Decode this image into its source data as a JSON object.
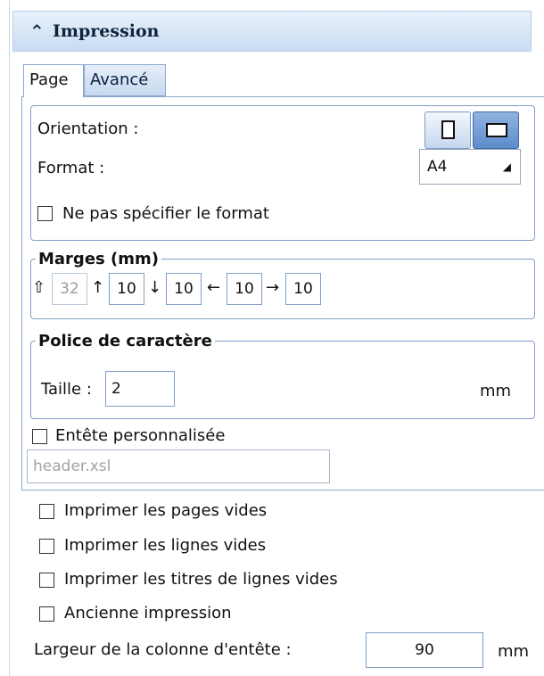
{
  "header": {
    "title": "Impression",
    "icon": "double-chevron-up-icon"
  },
  "tabs": [
    {
      "label": "Page"
    },
    {
      "label": "Avancé"
    }
  ],
  "orientation": {
    "label": "Orientation :"
  },
  "format": {
    "label": "Format :",
    "value": "A4"
  },
  "no_format": {
    "label": "Ne pas spécifier le format"
  },
  "marges": {
    "title": "Marges (mm)",
    "fields": [
      {
        "arrow": "⇧",
        "value": "32"
      },
      {
        "arrow": "↑",
        "value": "10"
      },
      {
        "arrow": "↓",
        "value": "10"
      },
      {
        "arrow": "←",
        "value": "10"
      },
      {
        "arrow": "→",
        "value": "10"
      }
    ]
  },
  "police": {
    "title": "Police de caractère",
    "size_label": "Taille :",
    "size_value": "2",
    "unit": "mm"
  },
  "custom_header": {
    "label": "Entête personnalisée",
    "file": "header.xsl"
  },
  "options": [
    {
      "label": "Imprimer les pages vides"
    },
    {
      "label": "Imprimer les lignes vides"
    },
    {
      "label": "Imprimer les titres de lignes vides"
    },
    {
      "label": "Ancienne impression"
    }
  ],
  "header_col": {
    "label": "Largeur de la colonne d'entête :",
    "value": "90",
    "unit": "mm"
  }
}
